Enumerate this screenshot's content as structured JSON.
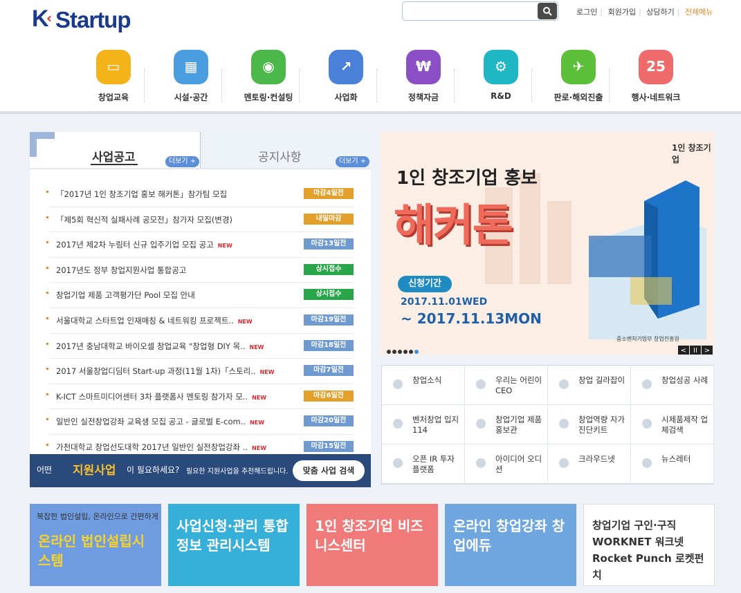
{
  "header": {
    "logo_k": "K",
    "logo_rest": "Startup",
    "search_placeholder": "",
    "links": [
      "로그인",
      "회원가입",
      "상담하기",
      "전체메뉴"
    ]
  },
  "menu": [
    {
      "label": "창업교육",
      "icon": "monitor-icon",
      "color": "#f5b31a"
    },
    {
      "label": "시설·공간",
      "icon": "building-icon",
      "color": "#4a9ee0"
    },
    {
      "label": "멘토링·컨설팅",
      "icon": "eye-icon",
      "color": "#4cb84a"
    },
    {
      "label": "사업화",
      "icon": "chart-icon",
      "color": "#4a80d8"
    },
    {
      "label": "정책자금",
      "icon": "money-bag-icon",
      "color": "#8a4fc4"
    },
    {
      "label": "R&D",
      "icon": "gear-icon",
      "color": "#1fb7c4"
    },
    {
      "label": "판로·해외진출",
      "icon": "airplane-icon",
      "color": "#5cbf3a"
    },
    {
      "label": "행사·네트워크",
      "icon": "calendar-icon",
      "color": "#ef6a6a"
    }
  ],
  "notice": {
    "tab_active": "사업공고",
    "tab_inactive": "공지사항",
    "more": "더보기 +",
    "rows": [
      {
        "title": "「2017년 1인 창조기업 홍보 해커톤」참가팀 모집",
        "new": false,
        "badge": "마감4일전",
        "badge_color": "#e3a02a"
      },
      {
        "title": "「제5회 혁신적 실패사례 공모전」참가자 모집(변경)",
        "new": false,
        "badge": "내일마감",
        "badge_color": "#e3a02a"
      },
      {
        "title": "2017년 제2차 누림터 신규 입주기업 모집 공고",
        "new": true,
        "badge": "마감13일전",
        "badge_color": "#6f9ad0"
      },
      {
        "title": "2017년도 정부 창업지원사업 통합공고",
        "new": false,
        "badge": "상시접수",
        "badge_color": "#2aa64a"
      },
      {
        "title": "창업기업 제품 고객평가단 Pool 모집 안내",
        "new": false,
        "badge": "상시접수",
        "badge_color": "#2aa64a"
      },
      {
        "title": "서울대학교 스타트업 인재매칭 & 네트워킹 프로젝트..",
        "new": true,
        "badge": "마감19일전",
        "badge_color": "#6f9ad0"
      },
      {
        "title": "2017년 충남대학교 바이오셀 창업교육 \"창업형 DIY 목..",
        "new": true,
        "badge": "마감18일전",
        "badge_color": "#6f9ad0"
      },
      {
        "title": "2017 서울창업디딤터 Start-up 과정(11월 1차)「스토리..",
        "new": true,
        "badge": "마감7일전",
        "badge_color": "#6f9ad0"
      },
      {
        "title": "K-ICT 스마트미디어센터 3차 플랫폼사 멘토링 참가자 모..",
        "new": true,
        "badge": "마감6일전",
        "badge_color": "#e3a02a"
      },
      {
        "title": "일반인 실전창업강좌 교육생 모집 공고 - 글로벌 E-com..",
        "new": true,
        "badge": "마감20일전",
        "badge_color": "#6f9ad0"
      },
      {
        "title": "가천대학교 창업선도대학 2017년 일반인 실전창업강좌 ..",
        "new": true,
        "badge": "마감15일전",
        "badge_color": "#6f9ad0"
      }
    ],
    "new_label": "NEW"
  },
  "recommend": {
    "a": "어떤",
    "b": "지원사업",
    "c": "이 필요하세요?",
    "d": "필요한 지원사업을 추천해드립니다.",
    "button": "맞춤 사업 검색"
  },
  "banner": {
    "brand": "1인 창조기업",
    "title1": "1인 창조기업 홍보",
    "title2": "해커톤",
    "period_label": "신청기간",
    "date1": "2017.11.01WED",
    "date2": "~ 2017.11.13MON",
    "logos": "중소벤처기업부   창업진흥원",
    "controls": [
      "<",
      "II",
      ">"
    ]
  },
  "quick": [
    {
      "label": "창업소식"
    },
    {
      "label": "우리는 어린이 CEO"
    },
    {
      "label": "창업 길라잡이"
    },
    {
      "label": "창업성공 사례"
    },
    {
      "label": "벤처창업 입지 114"
    },
    {
      "label": "창업기업 제품홍보관"
    },
    {
      "label": "창업역량 자가진단키트"
    },
    {
      "label": "시제품제작 업체검색"
    },
    {
      "label": "오픈 IR 투자 플랫폼"
    },
    {
      "label": "아이디어 오디션"
    },
    {
      "label": "크라우드넷"
    },
    {
      "label": "뉴스레터"
    }
  ],
  "bottom": [
    {
      "small": "복잡한 법인설립, 온라인으로 간편하게",
      "big": "온라인 법인설립시스템",
      "bg": "#6f9ce0"
    },
    {
      "small": "",
      "big": "사업신청·관리 통합정보 관리시스템",
      "bg": "#36b0d8"
    },
    {
      "small": "",
      "big": "1인 창조기업 비즈니스센터",
      "bg": "#f07a7a"
    },
    {
      "small": "",
      "big": "온라인 창업강좌 창업에듀",
      "bg": "#6fa6e0"
    },
    {
      "small": "",
      "big": "창업기업 구인·구직 WORKNET 워크넷 Rocket Punch 로켓펀치",
      "bg": "#ffffff"
    }
  ]
}
